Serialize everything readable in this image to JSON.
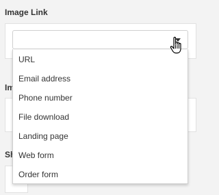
{
  "image_link": {
    "label": "Image Link",
    "select_value": "",
    "options": [
      "URL",
      "Email address",
      "Phone number",
      "File download",
      "Landing page",
      "Web form",
      "Order form"
    ]
  },
  "second_section": {
    "label_partial": "Im"
  },
  "third_section": {
    "label_partial": "Sh"
  },
  "colors": {
    "background": "#f3f3f3",
    "panel": "#ffffff",
    "text": "#333333",
    "border": "#cfcfcf"
  },
  "icons": [
    "caret-down-icon",
    "hand-pointer-icon"
  ]
}
